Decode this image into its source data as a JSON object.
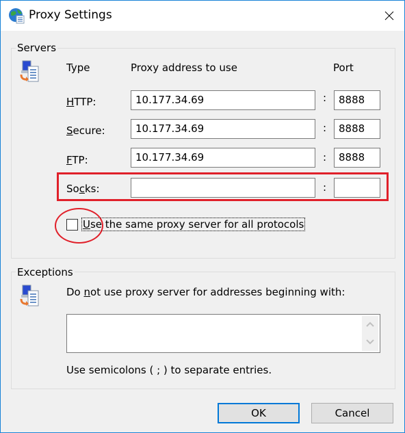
{
  "window": {
    "title": "Proxy Settings",
    "icon": "globe-settings-icon",
    "close_icon": "close-icon"
  },
  "servers": {
    "group_label": "Servers",
    "icon": "network-computer-icon",
    "col_type": "Type",
    "col_address": "Proxy address to use",
    "col_port": "Port",
    "rows": [
      {
        "label_prefix": "",
        "label_accel": "H",
        "label_rest": "TTP:",
        "address": "10.177.34.69",
        "port": "8888"
      },
      {
        "label_prefix": "",
        "label_accel": "S",
        "label_rest": "ecure:",
        "address": "10.177.34.69",
        "port": "8888"
      },
      {
        "label_prefix": "",
        "label_accel": "F",
        "label_rest": "TP:",
        "address": "10.177.34.69",
        "port": "8888"
      },
      {
        "label_prefix": "So",
        "label_accel": "c",
        "label_rest": "ks:",
        "address": "",
        "port": ""
      }
    ],
    "colon": ":",
    "same_proxy": {
      "accel": "U",
      "rest": "se the same proxy server for all protocols",
      "checked": false
    }
  },
  "exceptions": {
    "group_label": "Exceptions",
    "icon": "network-computer-icon",
    "desc_prefix": "Do ",
    "desc_accel": "n",
    "desc_rest": "ot use proxy server for addresses beginning with:",
    "value": "",
    "hint": "Use semicolons ( ; ) to separate entries."
  },
  "buttons": {
    "ok": "OK",
    "cancel": "Cancel"
  },
  "annotations": {
    "color": "#e0202a"
  }
}
